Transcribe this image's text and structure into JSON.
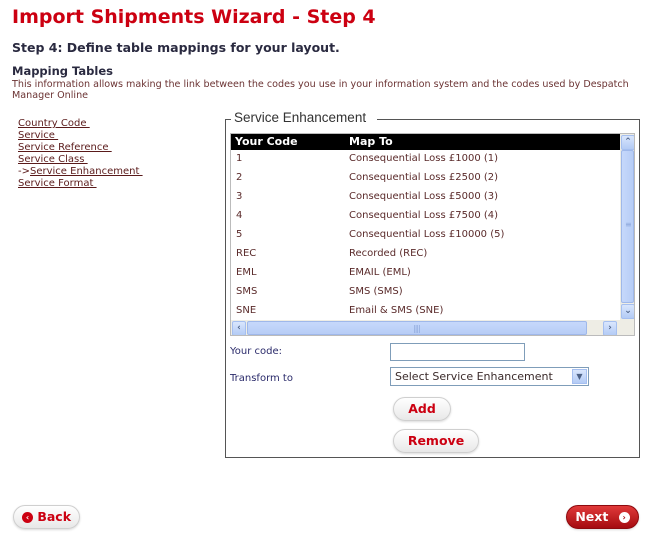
{
  "header": {
    "title": "Import Shipments Wizard - Step 4",
    "subtitle": "Step 4: Define table mappings for your layout.",
    "section_title": "Mapping Tables",
    "section_description": "This information allows making the link between the codes you use in your information system and the codes used by Despatch Manager Online"
  },
  "nav": {
    "items": [
      {
        "label": "Country Code ",
        "current": false
      },
      {
        "label": "Service ",
        "current": false
      },
      {
        "label": "Service Reference ",
        "current": false
      },
      {
        "label": "Service Class ",
        "current": false
      },
      {
        "label": "Service Enhancement ",
        "current": true,
        "prefix": "->"
      },
      {
        "label": "Service Format ",
        "current": false
      }
    ]
  },
  "panel": {
    "legend": "Service Enhancement",
    "table": {
      "columns": [
        "Your Code",
        "Map To"
      ],
      "rows": [
        [
          "1",
          "Consequential Loss £1000 (1)"
        ],
        [
          "2",
          "Consequential Loss £2500 (2)"
        ],
        [
          "3",
          "Consequential Loss £5000 (3)"
        ],
        [
          "4",
          "Consequential Loss £7500 (4)"
        ],
        [
          "5",
          "Consequential Loss £10000 (5)"
        ],
        [
          "REC",
          "Recorded (REC)"
        ],
        [
          "EML",
          "EMAIL (EML)"
        ],
        [
          "SMS",
          "SMS (SMS)"
        ],
        [
          "SNE",
          "Email & SMS (SNE)"
        ]
      ]
    },
    "form": {
      "your_code_label": "Your code:",
      "your_code_value": "",
      "transform_label": "Transform to",
      "transform_selected": "Select Service Enhancement"
    },
    "buttons": {
      "add": "Add",
      "remove": "Remove"
    }
  },
  "footer": {
    "back": "Back",
    "next": "Next"
  },
  "icons": {
    "back": "chevron-left-circle-icon",
    "next": "chevron-right-circle-icon",
    "scroll_up": "arrow-up-icon",
    "scroll_down": "arrow-down-icon",
    "scroll_left": "arrow-left-icon",
    "scroll_right": "arrow-right-icon",
    "dropdown": "chevron-down-icon"
  },
  "colors": {
    "brand_red": "#cc0011",
    "table_header_bg": "#000000",
    "scrollbar_blue": "#b7cdf6"
  }
}
